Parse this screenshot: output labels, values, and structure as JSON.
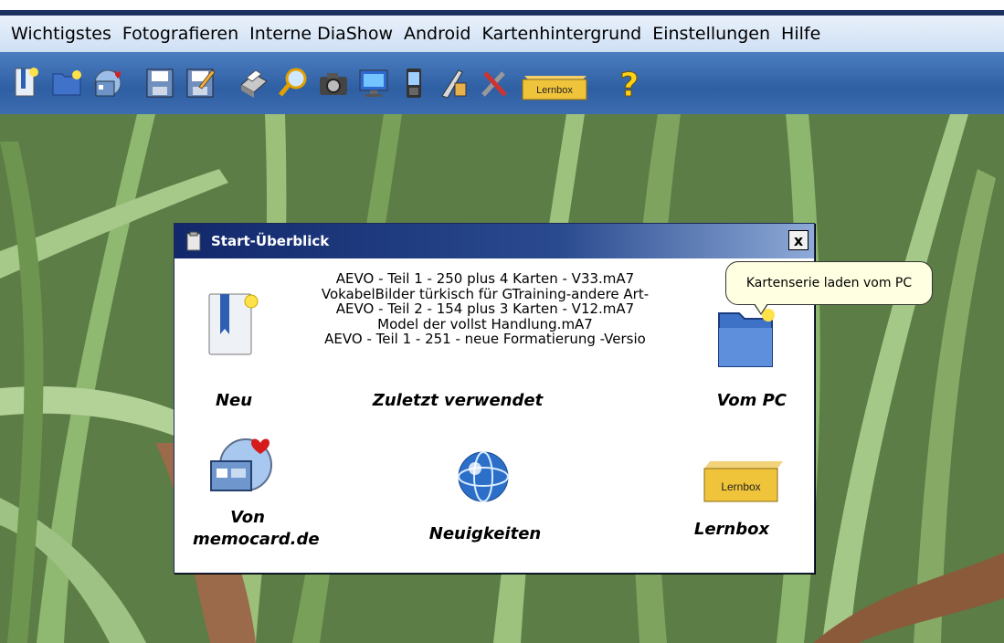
{
  "menu": {
    "items": [
      "Wichtigstes",
      "Fotografieren",
      "Interne DiaShow",
      "Android",
      "Kartenhintergrund",
      "Einstellungen",
      "Hilfe"
    ]
  },
  "toolbar": {
    "icons": [
      "new-file-icon",
      "folder-icon",
      "memocard-download-icon",
      "save-icon",
      "save-as-icon",
      "print-icon",
      "search-icon",
      "camera-icon",
      "monitor-icon",
      "phone-icon",
      "paint-icon",
      "tools-icon",
      "lernbox-icon",
      "help-icon"
    ],
    "lernbox_label": "Lernbox",
    "help_glyph": "?"
  },
  "dialog": {
    "title": "Start-Überblick",
    "close_glyph": "x",
    "recent_files": [
      "AEVO - Teil 1 - 250 plus 4 Karten - V33.mA7",
      "VokabelBilder türkisch für GTraining-andere Art-",
      "AEVO - Teil 2 - 154 plus 3 Karten - V12.mA7",
      "Model der vollst Handlung.mA7",
      "AEVO - Teil 1 - 251 - neue Formatierung -Versio"
    ],
    "labels": {
      "new": "Neu",
      "recent": "Zuletzt verwendet",
      "from_pc": "Vom PC",
      "from_memocard_line1": "Von",
      "from_memocard_line2": "memocard.de",
      "news": "Neuigkeiten",
      "lernbox": "Lernbox"
    },
    "lernbox_box_label": "Lernbox"
  },
  "tooltip": {
    "text": "Kartenserie laden vom PC"
  }
}
